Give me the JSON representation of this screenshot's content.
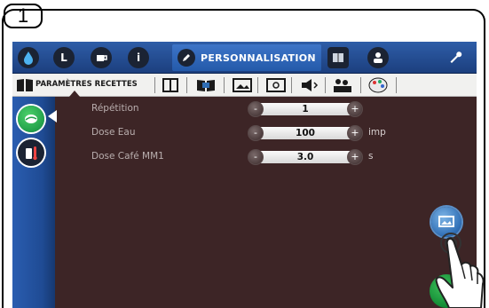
{
  "step": {
    "number": "1"
  },
  "top_nav": {
    "active_tab_label": "PERSONNALISATION",
    "icons": [
      "water-drop-icon",
      "size-icon",
      "cup-icon",
      "info-icon",
      "pencil-icon",
      "book-icon",
      "user-icon",
      "wrench-icon"
    ],
    "letters": {
      "size": "L",
      "info": "i"
    }
  },
  "sub_nav": {
    "active_label": "PARAMÈTRES RECETTES",
    "icons": [
      "recipe-book-icon",
      "book-icon",
      "open-book-icon",
      "image-icon",
      "frame-icon",
      "speaker-icon",
      "figures-icon",
      "palette-icon"
    ]
  },
  "sidebar": {
    "items": [
      {
        "name": "coffee-recipe",
        "color": "#22a04a"
      },
      {
        "name": "milk-temperature",
        "color": "#1b2333"
      }
    ]
  },
  "params": [
    {
      "label": "Répétition",
      "value": "1",
      "unit": ""
    },
    {
      "label": "Dose Eau",
      "value": "100",
      "unit": "imp"
    },
    {
      "label": "Dose Café MM1",
      "value": "3.0",
      "unit": "s"
    }
  ],
  "stepper_buttons": {
    "minus": "-",
    "plus": "+"
  },
  "colors": {
    "screen_bg": "#3d2526",
    "topbar": "#245aaa",
    "accent_green": "#22a04a",
    "label_text": "#b9aeae"
  }
}
